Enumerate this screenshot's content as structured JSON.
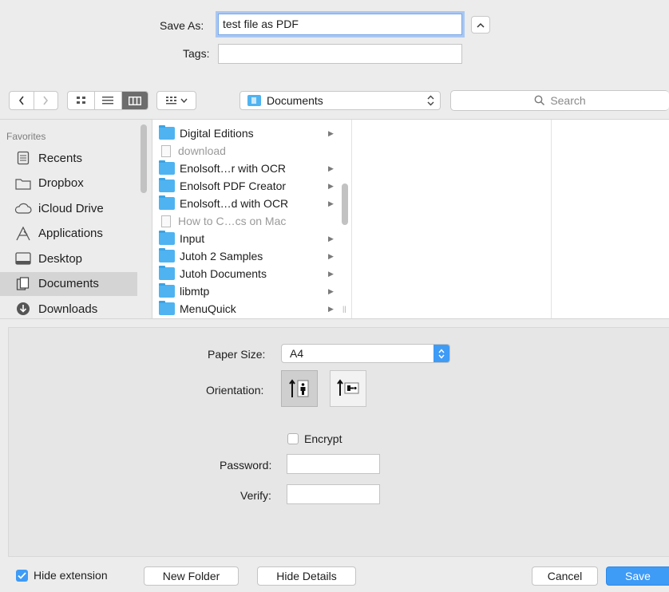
{
  "save_as": {
    "label": "Save As:",
    "value": "test file as PDF"
  },
  "tags": {
    "label": "Tags:",
    "value": ""
  },
  "toolbar": {
    "location": "Documents",
    "search_placeholder": "Search"
  },
  "sidebar": {
    "heading": "Favorites",
    "items": [
      {
        "label": "Recents",
        "icon": "recents-icon",
        "selected": false
      },
      {
        "label": "Dropbox",
        "icon": "folder-icon",
        "selected": false
      },
      {
        "label": "iCloud Drive",
        "icon": "cloud-icon",
        "selected": false
      },
      {
        "label": "Applications",
        "icon": "applications-icon",
        "selected": false
      },
      {
        "label": "Desktop",
        "icon": "desktop-icon",
        "selected": false
      },
      {
        "label": "Documents",
        "icon": "documents-icon",
        "selected": true
      },
      {
        "label": "Downloads",
        "icon": "downloads-icon",
        "selected": false
      }
    ]
  },
  "files": [
    {
      "name": "Digital Editions",
      "type": "folder",
      "has_children": true
    },
    {
      "name": "download",
      "type": "file",
      "has_children": false
    },
    {
      "name": "Enolsoft…r with OCR",
      "type": "folder",
      "has_children": true
    },
    {
      "name": "Enolsoft PDF Creator",
      "type": "folder",
      "has_children": true
    },
    {
      "name": "Enolsoft…d with OCR",
      "type": "folder",
      "has_children": true
    },
    {
      "name": "How to C…cs on Mac",
      "type": "file",
      "has_children": false
    },
    {
      "name": "Input",
      "type": "folder",
      "has_children": true
    },
    {
      "name": "Jutoh 2 Samples",
      "type": "folder",
      "has_children": true
    },
    {
      "name": "Jutoh Documents",
      "type": "folder",
      "has_children": true
    },
    {
      "name": "libmtp",
      "type": "folder",
      "has_children": true
    },
    {
      "name": "MenuQuick",
      "type": "folder",
      "has_children": true
    }
  ],
  "options": {
    "paper_size_label": "Paper Size:",
    "paper_size_value": "A4",
    "orientation_label": "Orientation:",
    "encrypt_label": "Encrypt",
    "encrypt_checked": false,
    "password_label": "Password:",
    "verify_label": "Verify:"
  },
  "footer": {
    "hide_extension_label": "Hide extension",
    "hide_extension_checked": true,
    "new_folder": "New Folder",
    "hide_details": "Hide Details",
    "cancel": "Cancel",
    "save": "Save"
  },
  "colors": {
    "accent": "#3e9bf6",
    "folder": "#4fb3f1"
  }
}
